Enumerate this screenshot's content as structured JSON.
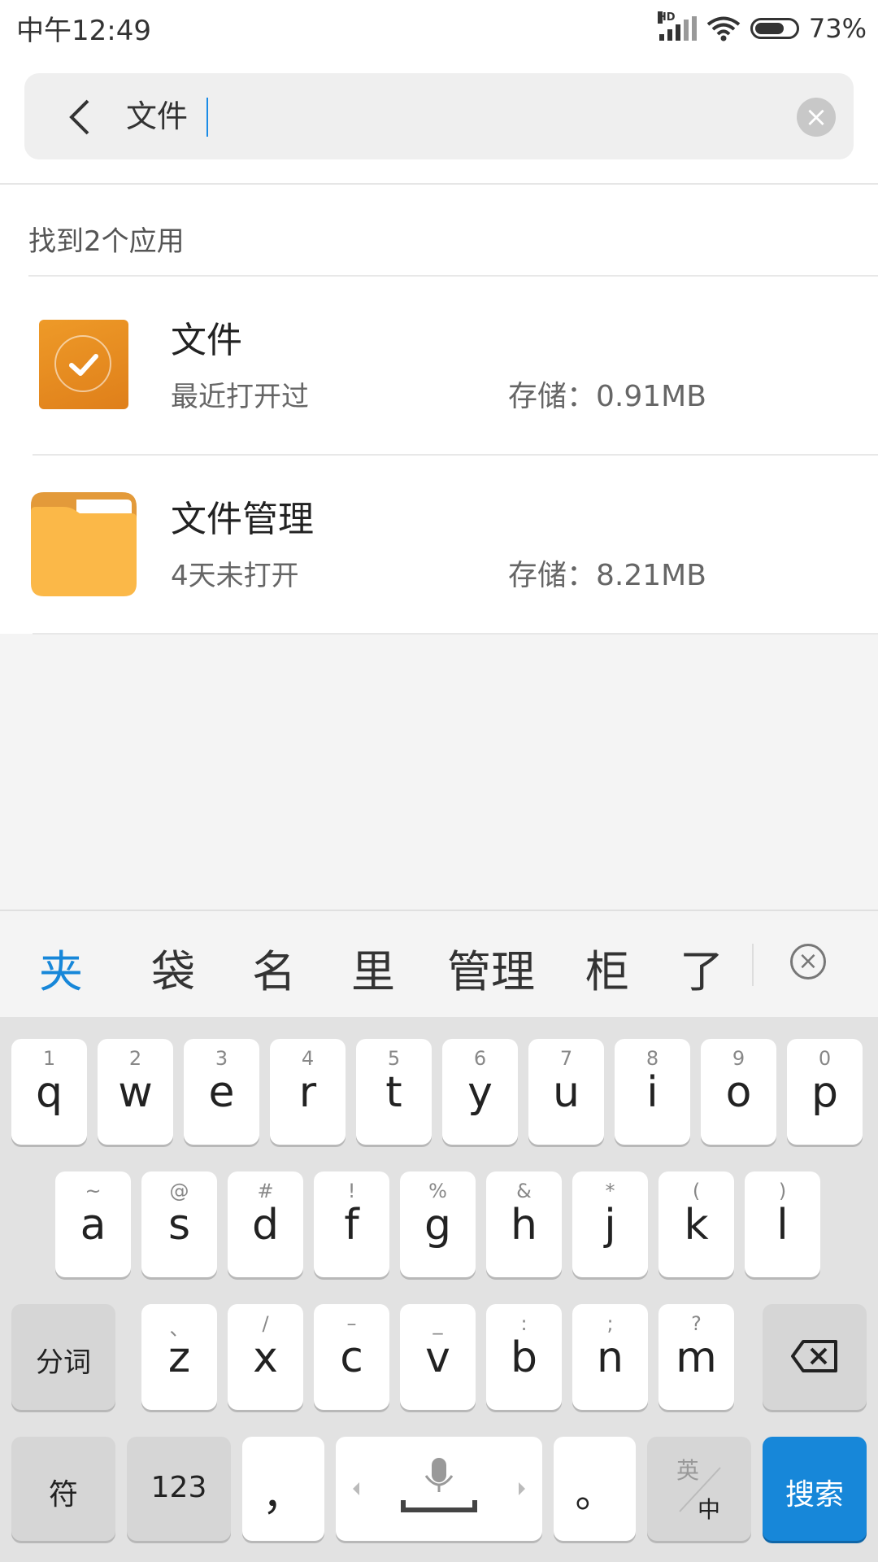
{
  "status_bar": {
    "time": "中午12:49",
    "network_badge": "HD",
    "battery_percent": "73%",
    "battery_level": 0.73
  },
  "search": {
    "query": "文件",
    "back_icon": "chevron-left-icon",
    "clear_icon": "close-circle-icon"
  },
  "results": {
    "count_label": "找到2个应用",
    "apps": [
      {
        "name": "文件",
        "subtitle": "最近打开过",
        "storage": "存储：0.91MB",
        "icon": "files-app-icon",
        "icon_color": "#e88a22"
      },
      {
        "name": "文件管理",
        "subtitle": "4天未打开",
        "storage": "存储：8.21MB",
        "icon": "folder-icon",
        "icon_color": "#fbb848"
      }
    ]
  },
  "keyboard": {
    "candidates": [
      "夹",
      "袋",
      "名",
      "里",
      "管理",
      "柜",
      "了"
    ],
    "candidate_active_color": "#1787d9",
    "row1": [
      {
        "k": "q",
        "s": "1"
      },
      {
        "k": "w",
        "s": "2"
      },
      {
        "k": "e",
        "s": "3"
      },
      {
        "k": "r",
        "s": "4"
      },
      {
        "k": "t",
        "s": "5"
      },
      {
        "k": "y",
        "s": "6"
      },
      {
        "k": "u",
        "s": "7"
      },
      {
        "k": "i",
        "s": "8"
      },
      {
        "k": "o",
        "s": "9"
      },
      {
        "k": "p",
        "s": "0"
      }
    ],
    "row2": [
      {
        "k": "a",
        "s": "~"
      },
      {
        "k": "s",
        "s": "@"
      },
      {
        "k": "d",
        "s": "#"
      },
      {
        "k": "f",
        "s": "!"
      },
      {
        "k": "g",
        "s": "%"
      },
      {
        "k": "h",
        "s": "&"
      },
      {
        "k": "j",
        "s": "*"
      },
      {
        "k": "k",
        "s": "("
      },
      {
        "k": "l",
        "s": ")"
      }
    ],
    "row3": [
      {
        "k": "z",
        "s": "、"
      },
      {
        "k": "x",
        "s": "/"
      },
      {
        "k": "c",
        "s": "–"
      },
      {
        "k": "v",
        "s": "_"
      },
      {
        "k": "b",
        "s": ":"
      },
      {
        "k": "n",
        "s": ";"
      },
      {
        "k": "m",
        "s": "?"
      }
    ],
    "segment_key": "分词",
    "symbol_key": "符",
    "number_key": "123",
    "comma_key": "，",
    "period_key": "。",
    "lang_top": "英",
    "lang_bottom": "中",
    "search_key": "搜索"
  }
}
